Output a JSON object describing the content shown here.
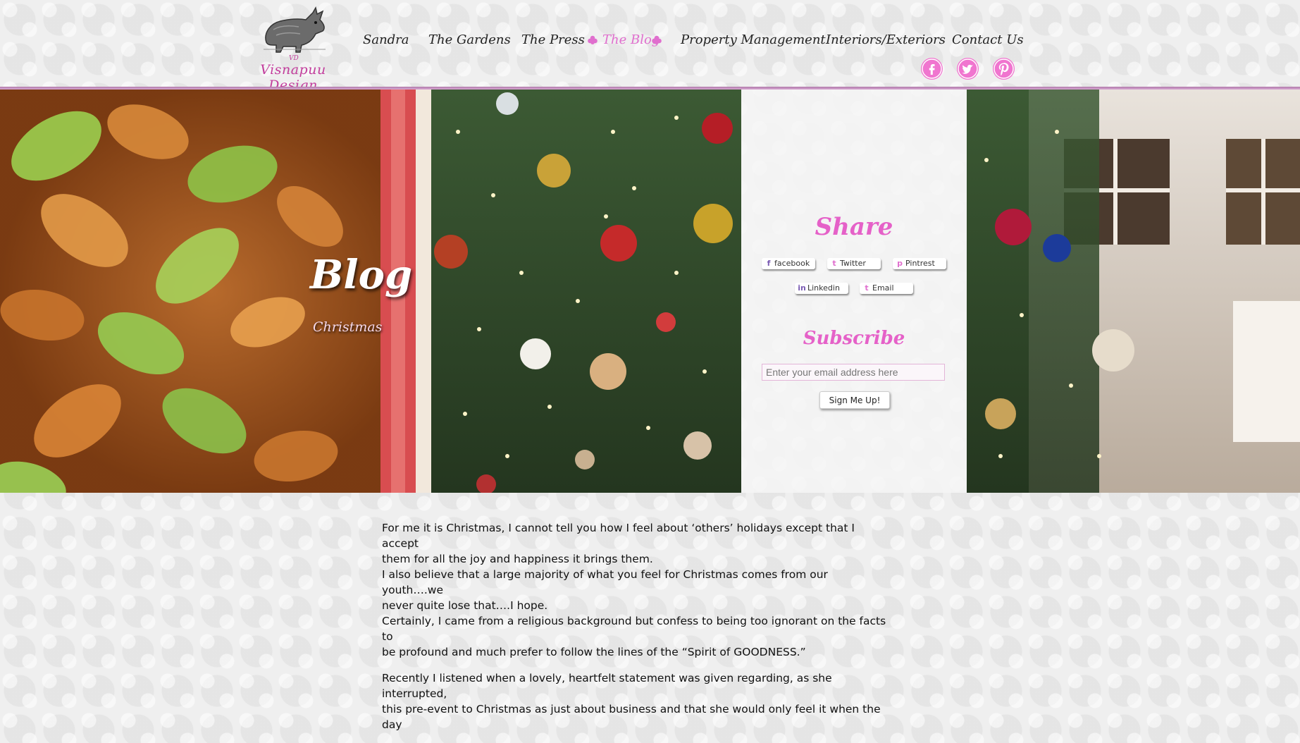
{
  "header": {
    "logo": {
      "brand": "Visnapuu Design",
      "small": "VD"
    },
    "nav": [
      {
        "label": "Sandra",
        "active": false
      },
      {
        "label": "The Gardens",
        "active": false
      },
      {
        "label": "The Press",
        "active": false
      },
      {
        "label": "The Blog",
        "active": true
      },
      {
        "label": "Property Management",
        "active": false
      },
      {
        "label": "Interiors/Exteriors",
        "active": false
      },
      {
        "label": "Contact Us",
        "active": false
      }
    ],
    "social": [
      {
        "icon": "facebook-icon"
      },
      {
        "icon": "twitter-icon"
      },
      {
        "icon": "pinterest-icon"
      }
    ],
    "accent_color": "#e06fce"
  },
  "hero": {
    "title": "Blog",
    "subtitle": "Christmas"
  },
  "share": {
    "heading": "Share",
    "buttons": [
      {
        "label": "facebook",
        "icon": "f"
      },
      {
        "label": "Twitter",
        "icon": "t"
      },
      {
        "label": "Pintrest",
        "icon": "p"
      },
      {
        "label": "Linkedin",
        "icon": "in"
      },
      {
        "label": "Email",
        "icon": "t"
      }
    ]
  },
  "subscribe": {
    "heading": "Subscribe",
    "placeholder": "Enter your email address here",
    "button": "Sign Me Up!"
  },
  "article": {
    "paragraphs": [
      [
        "For me it is Christmas, I cannot tell you how I feel about ‘others’ holidays except that I accept",
        "them for all the joy and happiness it brings them.",
        "I also believe that a large majority of what you feel for Christmas comes from our youth….we",
        "never quite lose that….I hope.",
        "Certainly, I came from a religious background but confess to being too ignorant on the facts to",
        "be profound and much prefer to follow the lines of the “Spirit of GOODNESS.”"
      ],
      [
        "Recently I listened when a lovely, heartfelt statement was given regarding, as she interrupted,",
        "this pre-event to Christmas as just about business and that she would only feel it when the day"
      ]
    ]
  }
}
